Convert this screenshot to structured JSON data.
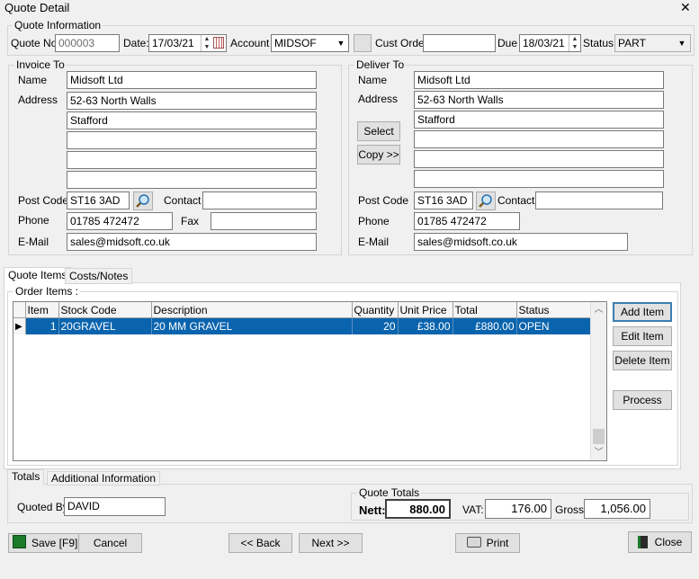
{
  "window": {
    "title": "Quote Detail",
    "close_glyph": "✕"
  },
  "quote_info": {
    "group_title": "Quote Information",
    "quote_no_label": "Quote No",
    "quote_no": "000003",
    "date_label": "Date:",
    "date": "17/03/21",
    "account_label": "Account",
    "account": "MIDSOF",
    "cust_order_label": "Cust Order",
    "cust_order": "",
    "due_label": "Due",
    "due": "18/03/21",
    "status_label": "Status:",
    "status": "PART"
  },
  "invoice_to": {
    "group_title": "Invoice To",
    "name_label": "Name",
    "name": "Midsoft Ltd",
    "address_label": "Address",
    "address": [
      "52-63 North Walls",
      "Stafford",
      "",
      "",
      ""
    ],
    "postcode_label": "Post Code",
    "postcode": "ST16 3AD",
    "contact_label": "Contact",
    "contact": "",
    "phone_label": "Phone",
    "phone": "01785 472472",
    "fax_label": "Fax",
    "fax": "",
    "email_label": "E-Mail",
    "email": "sales@midsoft.co.uk"
  },
  "deliver_to": {
    "group_title": "Deliver To",
    "name_label": "Name",
    "name": "Midsoft Ltd",
    "address_label": "Address",
    "address": [
      "52-63 North Walls",
      "Stafford",
      "",
      "",
      ""
    ],
    "select_label": "Select",
    "copy_label": "Copy >>",
    "postcode_label": "Post Code",
    "postcode": "ST16 3AD",
    "contact_label": "Contact",
    "contact": "",
    "phone_label": "Phone",
    "phone": "01785 472472",
    "email_label": "E-Mail",
    "email": "sales@midsoft.co.uk"
  },
  "tabs": {
    "quote_items": "Quote Items",
    "costs_notes": "Costs/Notes"
  },
  "order_items": {
    "group_title": "Order Items :",
    "columns": [
      "Item",
      "Stock Code",
      "Description",
      "Quantity",
      "Unit Price",
      "Total",
      "Status"
    ],
    "rows": [
      {
        "item": "1",
        "stock_code": "20GRAVEL",
        "description": "20 MM GRAVEL",
        "quantity": "20",
        "unit_price": "£38.00",
        "total": "£880.00",
        "status": "OPEN"
      }
    ],
    "add_item": "Add Item",
    "edit_item": "Edit Item",
    "delete_item": "Delete Item",
    "process": "Process"
  },
  "bottom_tabs": {
    "totals": "Totals",
    "additional": "Additional Information"
  },
  "totals": {
    "quoted_by_label": "Quoted By:",
    "quoted_by": "DAVID",
    "group_title": "Quote Totals",
    "nett_label": "Nett:",
    "nett": "880.00",
    "vat_label": "VAT:",
    "vat": "176.00",
    "gross_label": "Gross:",
    "gross": "1,056.00"
  },
  "footer": {
    "save": "Save [F9]",
    "cancel": "Cancel",
    "back": "<< Back",
    "next": "Next >>",
    "print": "Print",
    "close": "Close"
  }
}
